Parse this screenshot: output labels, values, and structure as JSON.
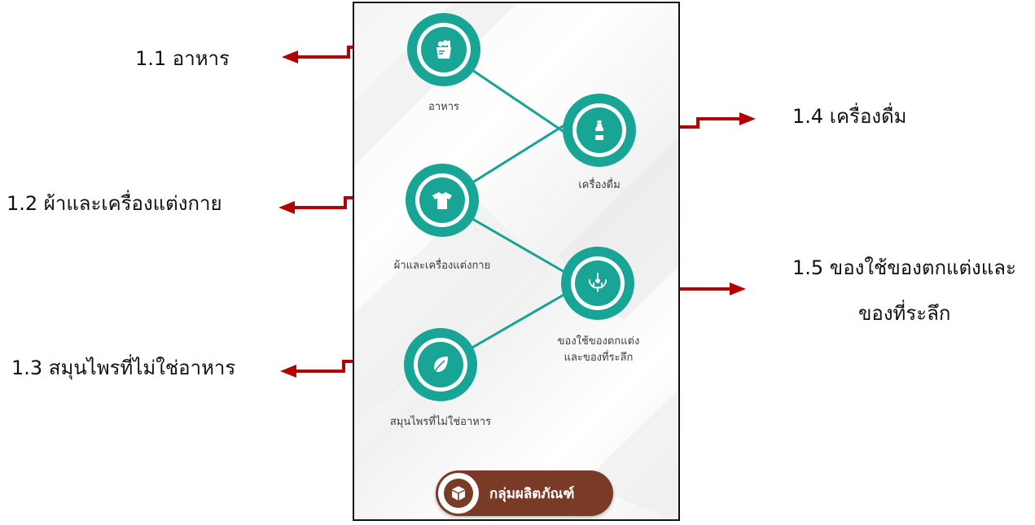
{
  "annotations": {
    "food": "1.1 อาหาร",
    "clothing": "1.2 ผ้าและเครื่องแต่งกาย",
    "herbal": "1.3 สมุนไพรที่ไม่ใช่อาหาร",
    "beverage": "1.4 เครื่องดื่ม",
    "decor_line1": "1.5 ของใช้ของตกแต่งและ",
    "decor_line2": "ของที่ระลึก"
  },
  "categories": {
    "food": {
      "label": "อาหาร",
      "icon": "grocery-bag-icon"
    },
    "beverage": {
      "label": "เครื่องดื่ม",
      "icon": "bottle-icon"
    },
    "clothing": {
      "label": "ผ้าและเครื่องแต่งกาย",
      "icon": "tshirt-icon"
    },
    "decor": {
      "label_line1": "ของใช้ของตกแต่ง",
      "label_line2": "และของที่ระลึก",
      "icon": "chandelier-icon"
    },
    "herbal": {
      "label": "สมุนไพรที่ไม่ใช่อาหาร",
      "icon": "leaf-icon"
    }
  },
  "product_group_button": {
    "label": "กลุ่มผลิตภัณฑ์",
    "icon": "box-icon"
  },
  "colors": {
    "teal": "#18a596",
    "brown": "#7a3b26",
    "arrow_red": "#b30000",
    "frame": "#111111"
  }
}
